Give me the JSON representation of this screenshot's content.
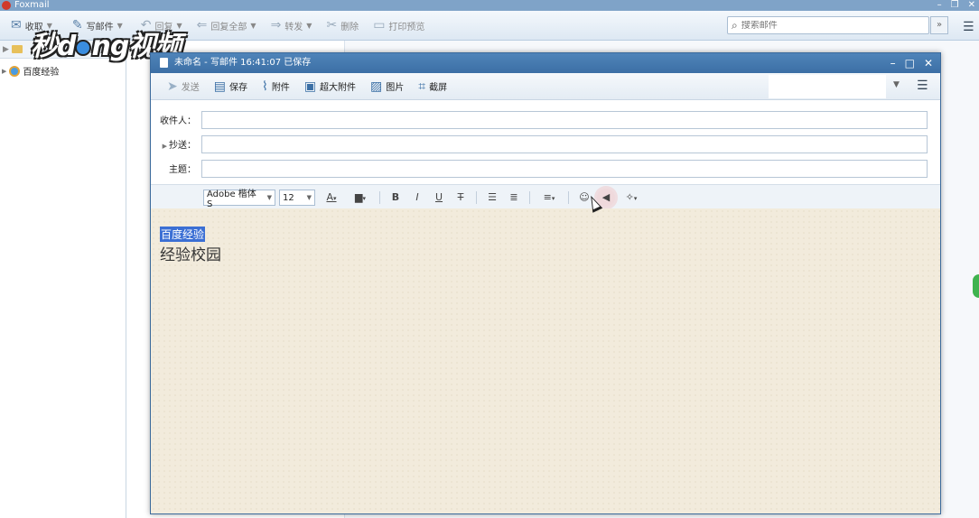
{
  "app": {
    "title": "Foxmail",
    "window_controls": [
      "–",
      "❐",
      "✕"
    ]
  },
  "toolbar": {
    "items": [
      {
        "label": "收取",
        "icon": "inbox-icon"
      },
      {
        "label": "写邮件",
        "icon": "pen-icon"
      },
      {
        "label": "回复",
        "icon": "reply-icon"
      },
      {
        "label": "回复全部",
        "icon": "reply-all-icon"
      },
      {
        "label": "转发",
        "icon": "forward-icon"
      },
      {
        "label": "删除",
        "icon": "delete-icon"
      },
      {
        "label": "打印预览",
        "icon": "print-icon"
      }
    ],
    "search_placeholder": "搜索邮件",
    "search_expand": "»"
  },
  "watermark": {
    "text_left": "秒d",
    "text_right": "ng视频"
  },
  "sidebar": {
    "account_name": "百度经验"
  },
  "compose": {
    "title": "未命名 - 写邮件   16:41:07 已保存",
    "window_controls": [
      "–",
      "□",
      "✕"
    ],
    "toolbar": {
      "send": "发送",
      "save": "保存",
      "attach": "附件",
      "big_attach": "超大附件",
      "image": "图片",
      "screenshot": "截屏"
    },
    "fields": {
      "to_label": "收件人：",
      "cc_label": "抄送：",
      "subject_label": "主题："
    },
    "format": {
      "font_family": "Adobe 楷体 S",
      "font_size": "12"
    },
    "body": {
      "line1": "百度经验",
      "line2": "经验校园"
    }
  },
  "colors": {
    "accent": "#3c6fa5",
    "selection": "#3b6fd4",
    "paper": "#f2ebdc"
  }
}
